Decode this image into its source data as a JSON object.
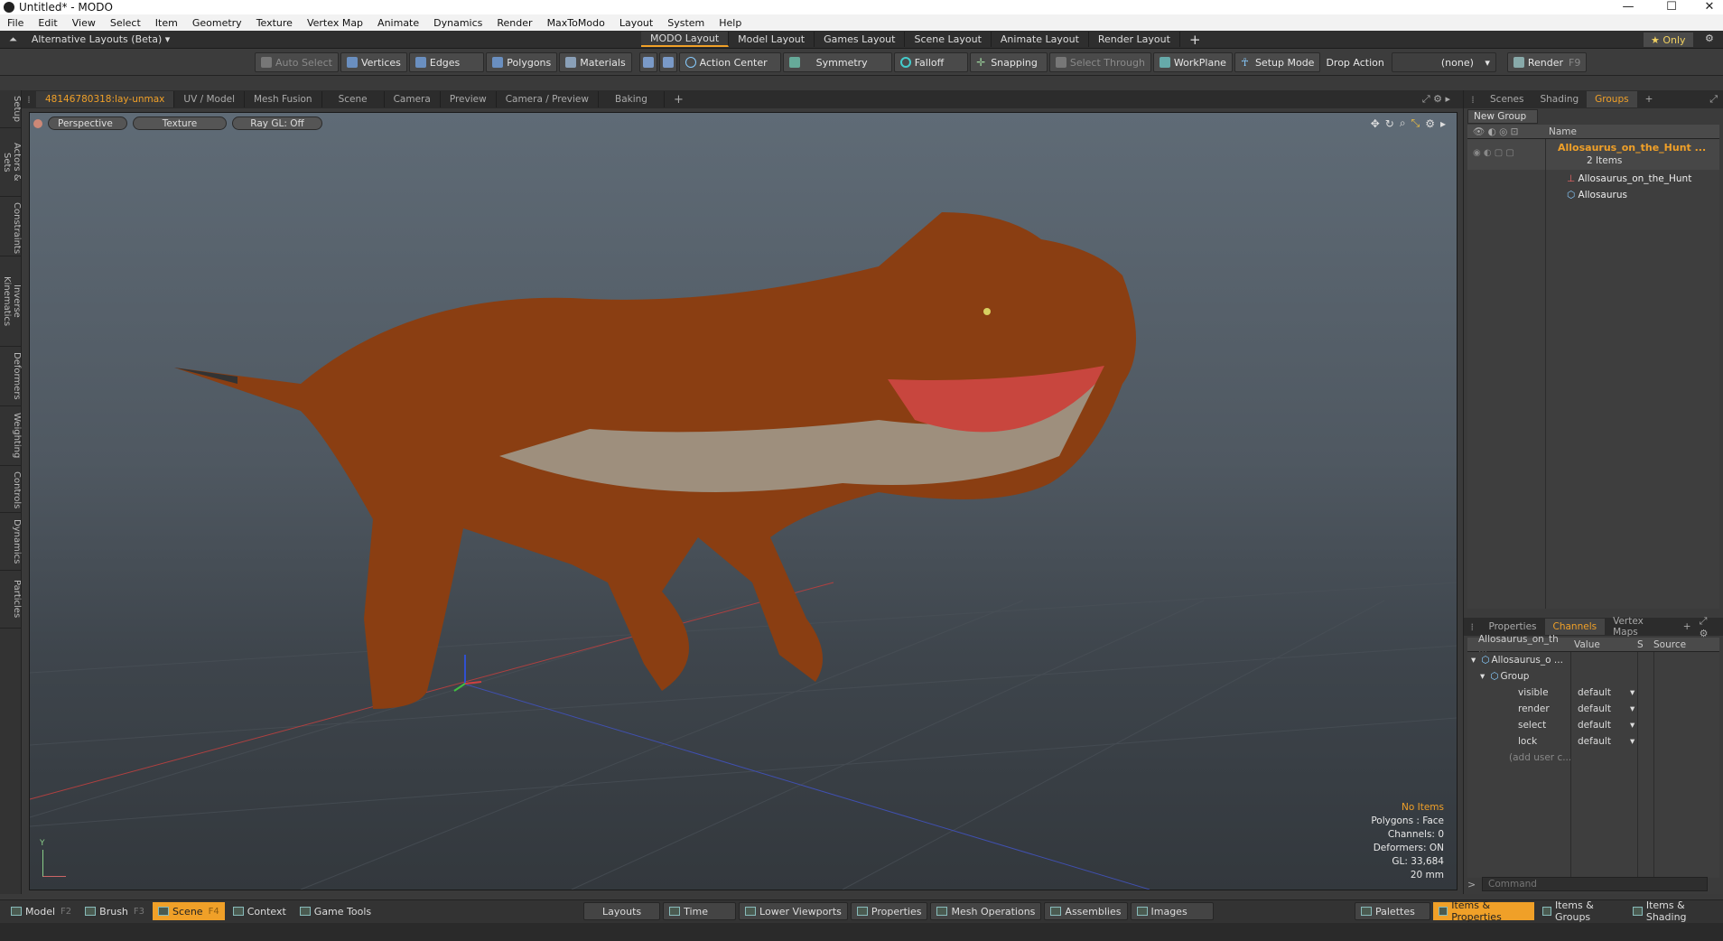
{
  "window": {
    "title": "Untitled* - MODO",
    "minimize": "—",
    "maximize": "☐",
    "close": "✕"
  },
  "menu": [
    "File",
    "Edit",
    "View",
    "Select",
    "Item",
    "Geometry",
    "Texture",
    "Vertex Map",
    "Animate",
    "Dynamics",
    "Render",
    "MaxToModo",
    "Layout",
    "System",
    "Help"
  ],
  "layouts": {
    "alt_label": "Alternative Layouts (Beta) ▾",
    "tabs": [
      "MODO Layout",
      "Model Layout",
      "Games Layout",
      "Scene Layout",
      "Animate Layout",
      "Render Layout"
    ],
    "active": "MODO Layout",
    "add": "+",
    "only": "★  Only"
  },
  "toolbar": {
    "auto_select": "Auto Select",
    "vertices": "Vertices",
    "edges": "Edges",
    "polygons": "Polygons",
    "materials": "Materials",
    "action_center": "Action Center",
    "symmetry": "Symmetry",
    "falloff": "Falloff",
    "snapping": "Snapping",
    "select_through": "Select Through",
    "workplane": "WorkPlane",
    "setup_mode": "Setup Mode",
    "drop_action": "Drop Action",
    "drop_value": "(none)",
    "render": "Render",
    "render_key": "F9"
  },
  "left_tabs": [
    "Setup",
    "Actors & Sets",
    "Constraints",
    "Inverse Kinematics",
    "Deformers",
    "Weighting",
    "Controls",
    "Dynamics",
    "Particles"
  ],
  "viewport_tabs": [
    "48146780318:lay-unmax",
    "UV / Model",
    "Mesh Fusion",
    "Scene",
    "Camera",
    "Preview",
    "Camera / Preview",
    "Baking",
    "+"
  ],
  "viewport": {
    "view": "Perspective",
    "shading": "Texture",
    "raygl": "Ray GL: Off",
    "axis_y": "Y",
    "stats": [
      "No Items",
      "Polygons : Face",
      "Channels: 0",
      "Deformers: ON",
      "GL: 33,684",
      "20 mm"
    ]
  },
  "groups_panel": {
    "tabs": [
      "Scenes",
      "Shading",
      "Groups",
      "+"
    ],
    "active": "Groups",
    "new_group": "New Group",
    "col_name": "Name",
    "root": "Allosaurus_on_the_Hunt ...",
    "count": "2 Items",
    "children": [
      "Allosaurus_on_the_Hunt",
      "Allosaurus"
    ]
  },
  "channels_panel": {
    "tabs": [
      "Properties",
      "Channels",
      "Vertex Maps",
      "+"
    ],
    "active": "Channels",
    "headers": [
      "Allosaurus_on_th ...",
      "Value",
      "S",
      "Source"
    ],
    "item": "Allosaurus_o ...",
    "group": "Group",
    "rows": [
      {
        "name": "visible",
        "value": "default"
      },
      {
        "name": "render",
        "value": "default"
      },
      {
        "name": "select",
        "value": "default"
      },
      {
        "name": "lock",
        "value": "default"
      }
    ],
    "add_user": "(add user c...",
    "command_placeholder": "Command",
    "prompt": ">"
  },
  "bottom": {
    "left": [
      {
        "label": "Model",
        "key": "F2"
      },
      {
        "label": "Brush",
        "key": "F3"
      },
      {
        "label": "Scene",
        "key": "F4"
      },
      {
        "label": "Context",
        "key": ""
      },
      {
        "label": "Game Tools",
        "key": ""
      }
    ],
    "middle": [
      "Layouts",
      "Time",
      "Lower Viewports",
      "Properties",
      "Mesh Operations",
      "Assemblies",
      "Images"
    ],
    "right": [
      "Palettes",
      "Items & Properties",
      "Items & Groups",
      "Items & Shading"
    ]
  },
  "colors": {
    "accent": "#f0a028",
    "panel": "#3b3b3b",
    "viewport_top": "#5f6b76"
  }
}
